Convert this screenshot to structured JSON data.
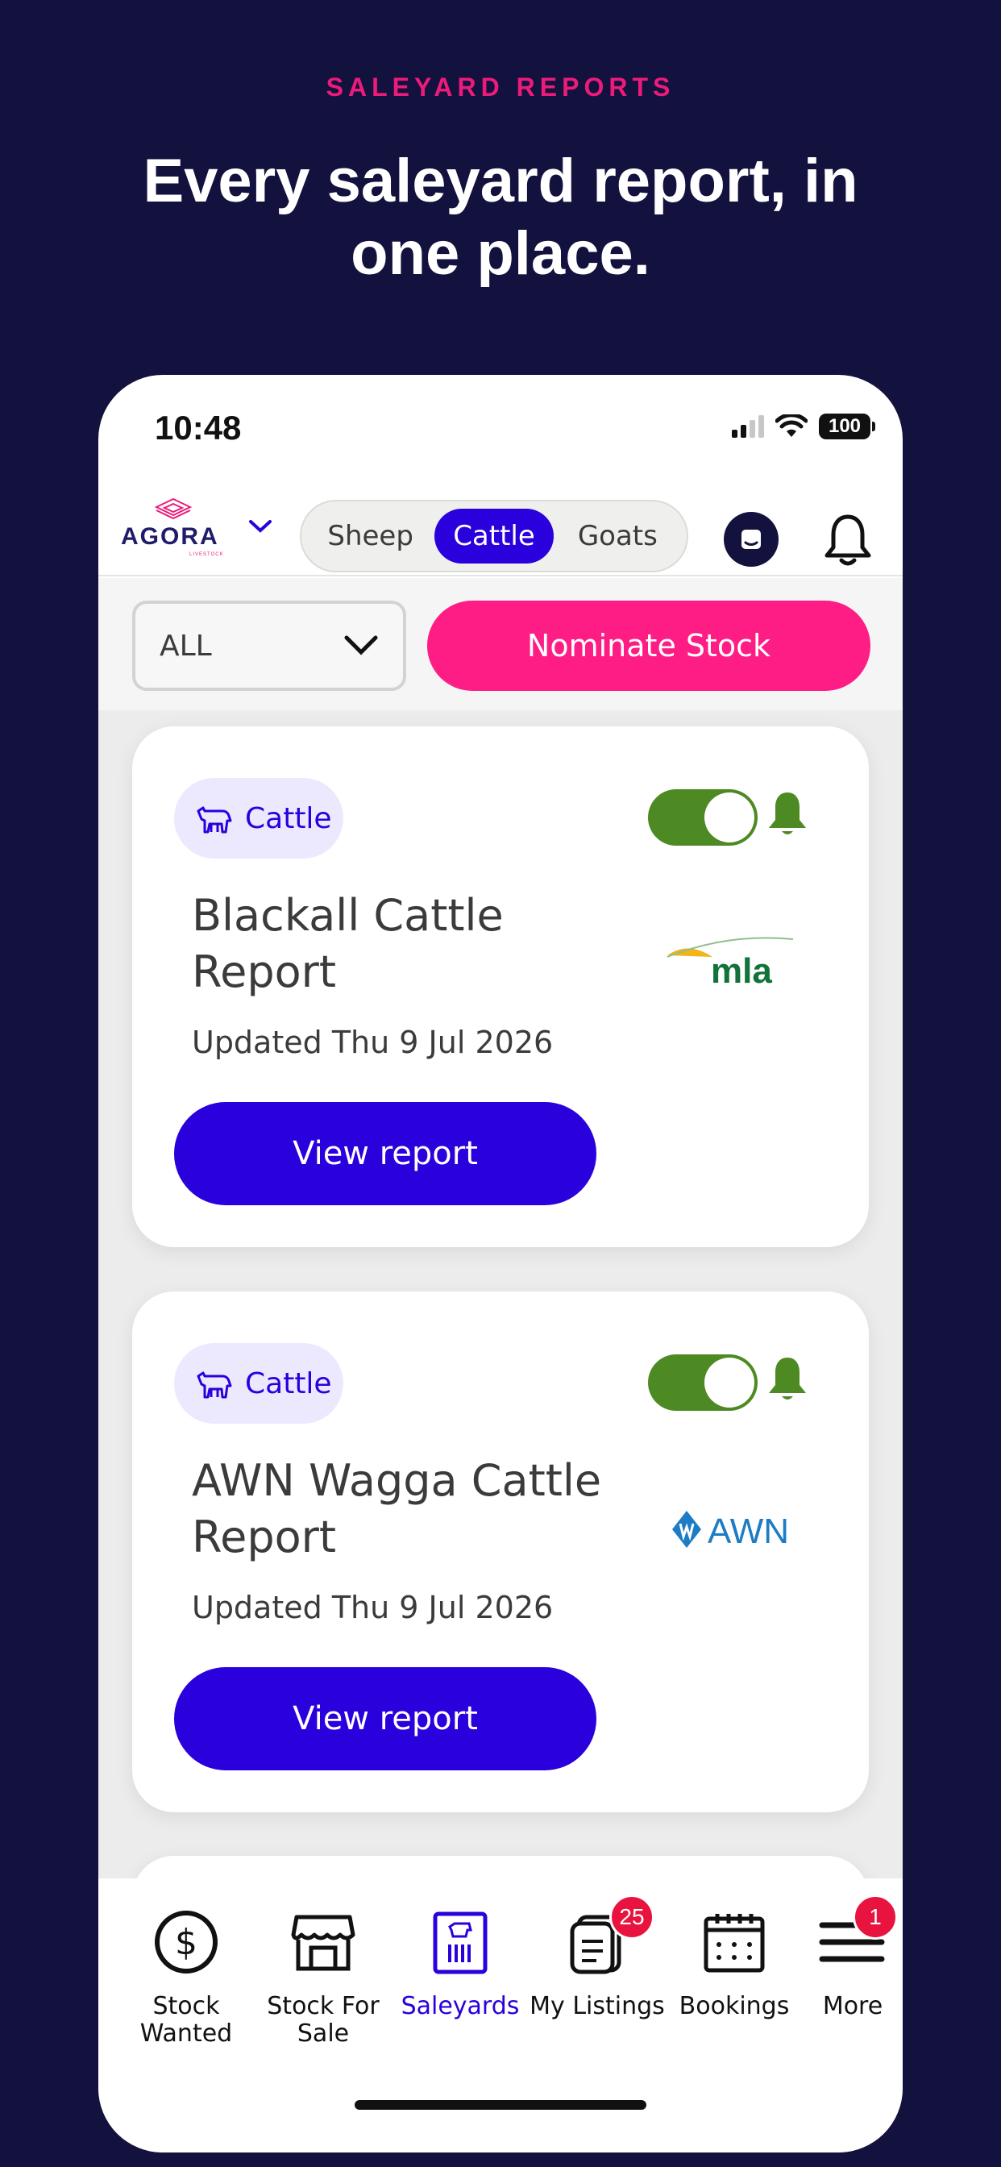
{
  "banner": {
    "eyebrow": "SALEYARD REPORTS",
    "headline": "Every saleyard report, in one place."
  },
  "status_bar": {
    "time": "10:48",
    "battery": "100"
  },
  "app_bar": {
    "logo_text": "AGORA",
    "logo_sub": "LIVESTOCK",
    "segments": [
      "Sheep",
      "Cattle",
      "Goats"
    ],
    "selected_segment": "Cattle"
  },
  "filter": {
    "select_value": "ALL",
    "nominate_label": "Nominate Stock"
  },
  "reports": [
    {
      "chip_label": "Cattle",
      "title": "Blackall Cattle Report",
      "updated": "Updated Thu 9 Jul 2026",
      "button_label": "View report",
      "brand": "mla",
      "alerts_on": true
    },
    {
      "chip_label": "Cattle",
      "title": "AWN Wagga Cattle Report",
      "updated": "Updated Thu 9 Jul 2026",
      "button_label": "View report",
      "brand": "AWN",
      "alerts_on": true
    }
  ],
  "tab_bar": {
    "items": [
      {
        "label": "Stock Wanted",
        "icon": "dollar-circle-icon"
      },
      {
        "label": "Stock For Sale",
        "icon": "storefront-icon"
      },
      {
        "label": "Saleyards",
        "icon": "saleyard-icon"
      },
      {
        "label": "My Listings",
        "icon": "listings-icon",
        "badge": "25"
      },
      {
        "label": "Bookings",
        "icon": "calendar-icon"
      },
      {
        "label": "More",
        "icon": "menu-icon",
        "badge": "1"
      }
    ],
    "active": "Saleyards"
  },
  "colors": {
    "background": "#13113d",
    "accent_pink": "#fe1c85",
    "primary_blue": "#2a00dc",
    "toggle_green": "#4e8a24",
    "badge_red": "#e8143f"
  }
}
